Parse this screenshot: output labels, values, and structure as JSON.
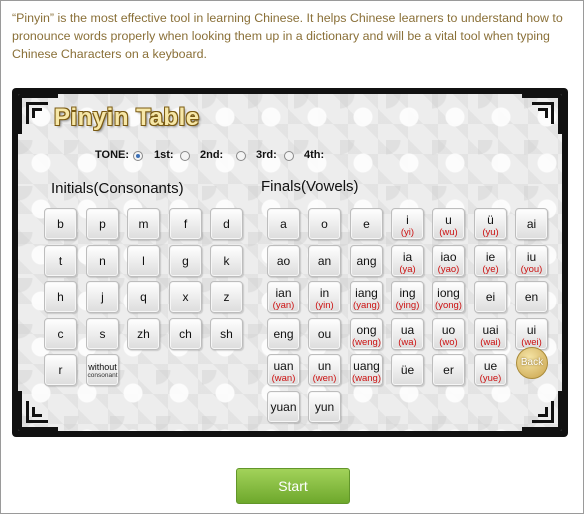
{
  "intro": "“Pinyin” is the most effective tool in learning Chinese. It helps Chinese learners to understand how to pronounce words properly when looking them up in a dictionary and will be a vital tool when typing Chinese Characters on a keyboard.",
  "title": "Pinyin Table",
  "tone": {
    "label": "TONE:",
    "options": [
      "1st:",
      "2nd:",
      "3rd:",
      "4th:"
    ],
    "selected": "TONE:"
  },
  "initials_heading": "Initials(Consonants)",
  "finals_heading": "Finals(Vowels)",
  "initials": [
    [
      "b",
      "p",
      "m",
      "f",
      "d"
    ],
    [
      "t",
      "n",
      "l",
      "g",
      "k"
    ],
    [
      "h",
      "j",
      "q",
      "x",
      "z"
    ],
    [
      "c",
      "s",
      "zh",
      "ch",
      "sh"
    ],
    [
      "r",
      {
        "main": "without",
        "sub": "consonant"
      }
    ]
  ],
  "finals": [
    [
      {
        "main": "a"
      },
      {
        "main": "o"
      },
      {
        "main": "e"
      },
      {
        "main": "i",
        "alt": "(yi)"
      },
      {
        "main": "u",
        "alt": "(wu)"
      },
      {
        "main": "ü",
        "alt": "(yu)"
      },
      {
        "main": "ai"
      }
    ],
    [
      {
        "main": "ao"
      },
      {
        "main": "an"
      },
      {
        "main": "ang"
      },
      {
        "main": "ia",
        "alt": "(ya)"
      },
      {
        "main": "iao",
        "alt": "(yao)"
      },
      {
        "main": "ie",
        "alt": "(ye)"
      },
      {
        "main": "iu",
        "alt": "(you)"
      }
    ],
    [
      {
        "main": "ian",
        "alt": "(yan)"
      },
      {
        "main": "in",
        "alt": "(yin)"
      },
      {
        "main": "iang",
        "alt": "(yang)"
      },
      {
        "main": "ing",
        "alt": "(ying)"
      },
      {
        "main": "iong",
        "alt": "(yong)"
      },
      {
        "main": "ei"
      },
      {
        "main": "en"
      }
    ],
    [
      {
        "main": "eng"
      },
      {
        "main": "ou"
      },
      {
        "main": "ong",
        "alt": "(weng)"
      },
      {
        "main": "ua",
        "alt": "(wa)"
      },
      {
        "main": "uo",
        "alt": "(wo)"
      },
      {
        "main": "uai",
        "alt": "(wai)"
      },
      {
        "main": "ui",
        "alt": "(wei)"
      }
    ],
    [
      {
        "main": "uan",
        "alt": "(wan)"
      },
      {
        "main": "un",
        "alt": "(wen)"
      },
      {
        "main": "uang",
        "alt": "(wang)"
      },
      {
        "main": "üe"
      },
      {
        "main": "er"
      },
      {
        "main": "ue",
        "alt": "(yue)"
      }
    ],
    [
      {
        "main": "yuan"
      },
      {
        "main": "yun"
      }
    ]
  ],
  "back_label": "Back",
  "start_label": "Start",
  "colors": {
    "intro_text": "#8a7038",
    "alt_text": "#c11111",
    "start_green": "#7cb83a"
  }
}
